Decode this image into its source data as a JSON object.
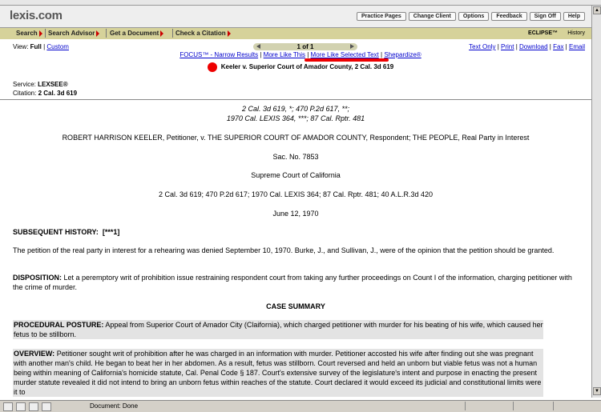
{
  "header": {
    "logo": "lexis.com",
    "utility_links": [
      "Practice Pages",
      "Change Client",
      "Options",
      "Feedback",
      "Sign Off",
      "Help"
    ],
    "nav_buttons": [
      "Search",
      "Search Advisor",
      "Get a Document",
      "Check a Citation"
    ],
    "eclipse": "ECLIPSE™",
    "history": "History"
  },
  "view": {
    "label": "View:",
    "full": "Full",
    "custom": "Custom"
  },
  "pager": {
    "text": "1 of 1"
  },
  "right_links": [
    "Text Only",
    "Print",
    "Download",
    "Fax",
    "Email"
  ],
  "tool_links": [
    "FOCUS™ - Narrow Results",
    "More Like This",
    "More Like Selected Text",
    "Shepardize®"
  ],
  "case_title": "Keeler v. Superior Court of Amador County, 2 Cal. 3d 619",
  "service": {
    "service_label": "Service:",
    "service": "LEXSEE®",
    "citation_label": "Citation:",
    "citation": "2 Cal. 3d 619"
  },
  "document": {
    "cite_line1": "2 Cal. 3d 619, *; 470 P.2d 617, **;",
    "cite_line2": "1970 Cal. LEXIS 364, ***; 87 Cal. Rptr. 481",
    "parties": "ROBERT HARRISON KEELER, Petitioner, v. THE SUPERIOR COURT OF AMADOR COUNTY, Respondent; THE PEOPLE, Real Party in Interest",
    "docket": "Sac. No. 7853",
    "court": "Supreme Court of California",
    "full_cite": "2 Cal. 3d 619; 470 P.2d 617; 1970 Cal. LEXIS 364; 87 Cal. Rptr. 481; 40 A.L.R.3d 420",
    "date": "June 12, 1970",
    "subsequent_label": "SUBSEQUENT HISTORY:",
    "subsequent_marker": "[***1]",
    "subsequent_text": "The petition of the real party in interest for a rehearing was denied September 10, 1970. Burke, J., and Sullivan, J., were of the opinion that the petition should be granted.",
    "disposition_label": "DISPOSITION:",
    "disposition_text": "Let a peremptory writ of prohibition issue restraining respondent court from taking any further proceedings on Count I of the information, charging petitioner with the crime of murder.",
    "summary_heading": "CASE SUMMARY",
    "posture_label": "PROCEDURAL POSTURE:",
    "posture_text": "Appeal from Superior Court of Amador City (Claifornia), which charged petitioner with murder for his beating of his wife, which caused her fetus to be stillborn.",
    "overview_label": "OVERVIEW:",
    "overview_text": "Petitioner sought writ of prohibition after he was charged in an information with murder. Petitioner accosted his wife after finding out she was pregnant with another man's child. He began to beat her in her abdomen. As a result, fetus was stillborn. Court reversed and held an unborn but viable fetus was not a human being within meaning of California's homicide statute, Cal. Penal Code § 187. Court's extensive survey of the legislature's intent and purpose in enacting the present murder statute revealed it did not intend to bring an unborn fetus within reaches of the statute. Court declared it would exceed its judicial and constitutional limits were it to"
  },
  "status": {
    "text": "Document: Done"
  }
}
